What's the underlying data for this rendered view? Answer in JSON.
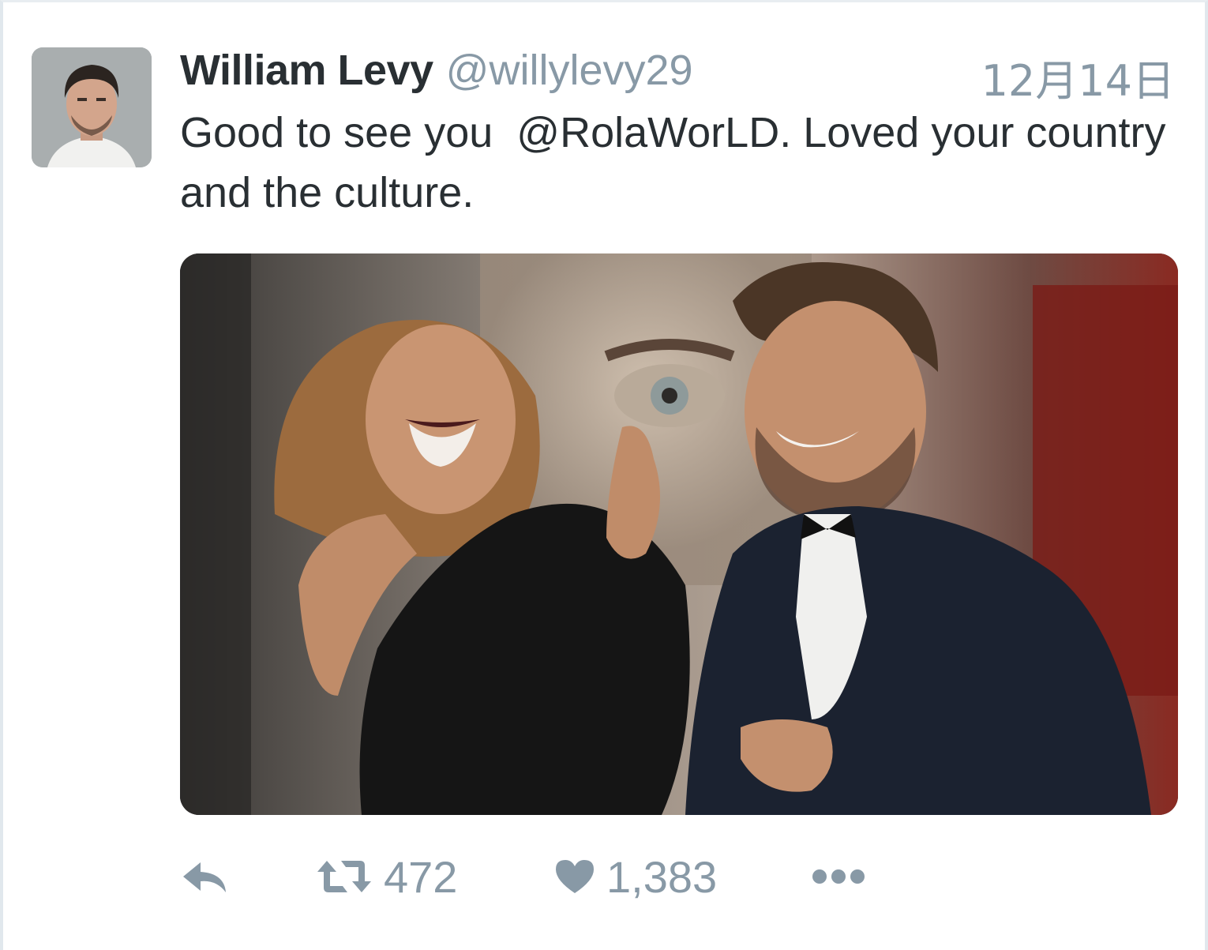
{
  "tweet": {
    "author": {
      "display_name": "William Levy",
      "handle": "@willylevy29",
      "avatar_icon": "profile-photo"
    },
    "timestamp": "12月14日",
    "text": "Good to see you  @RolaWorLD. Loved your country and the culture.",
    "media": {
      "alt": "photo"
    },
    "actions": {
      "reply_icon": "reply-icon",
      "retweet_icon": "retweet-icon",
      "retweet_count": "472",
      "like_icon": "heart-icon",
      "like_count": "1,383",
      "more_icon": "more-icon"
    }
  },
  "colors": {
    "text_primary": "#292f33",
    "text_secondary": "#8899a6",
    "border": "#e1e8ed"
  }
}
